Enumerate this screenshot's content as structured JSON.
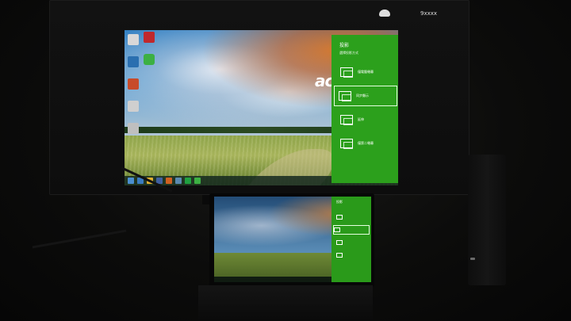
{
  "monitor": {
    "top_label": "9xxxx",
    "brand": "acer"
  },
  "charm": {
    "title": "投影",
    "subtitle": "選擇投影方式",
    "options": [
      {
        "label": "僅電腦螢幕",
        "icon": "pc-screen-only-icon",
        "selected": false
      },
      {
        "label": "同步顯示",
        "icon": "duplicate-icon",
        "selected": true
      },
      {
        "label": "延伸",
        "icon": "extend-icon",
        "selected": false
      },
      {
        "label": "僅第二螢幕",
        "icon": "second-screen-only-icon",
        "selected": false
      }
    ]
  },
  "tablet_charm": {
    "title": "投影"
  },
  "colors": {
    "charm_green": "#2ca01c",
    "sky_blue": "#3d7fb0"
  }
}
